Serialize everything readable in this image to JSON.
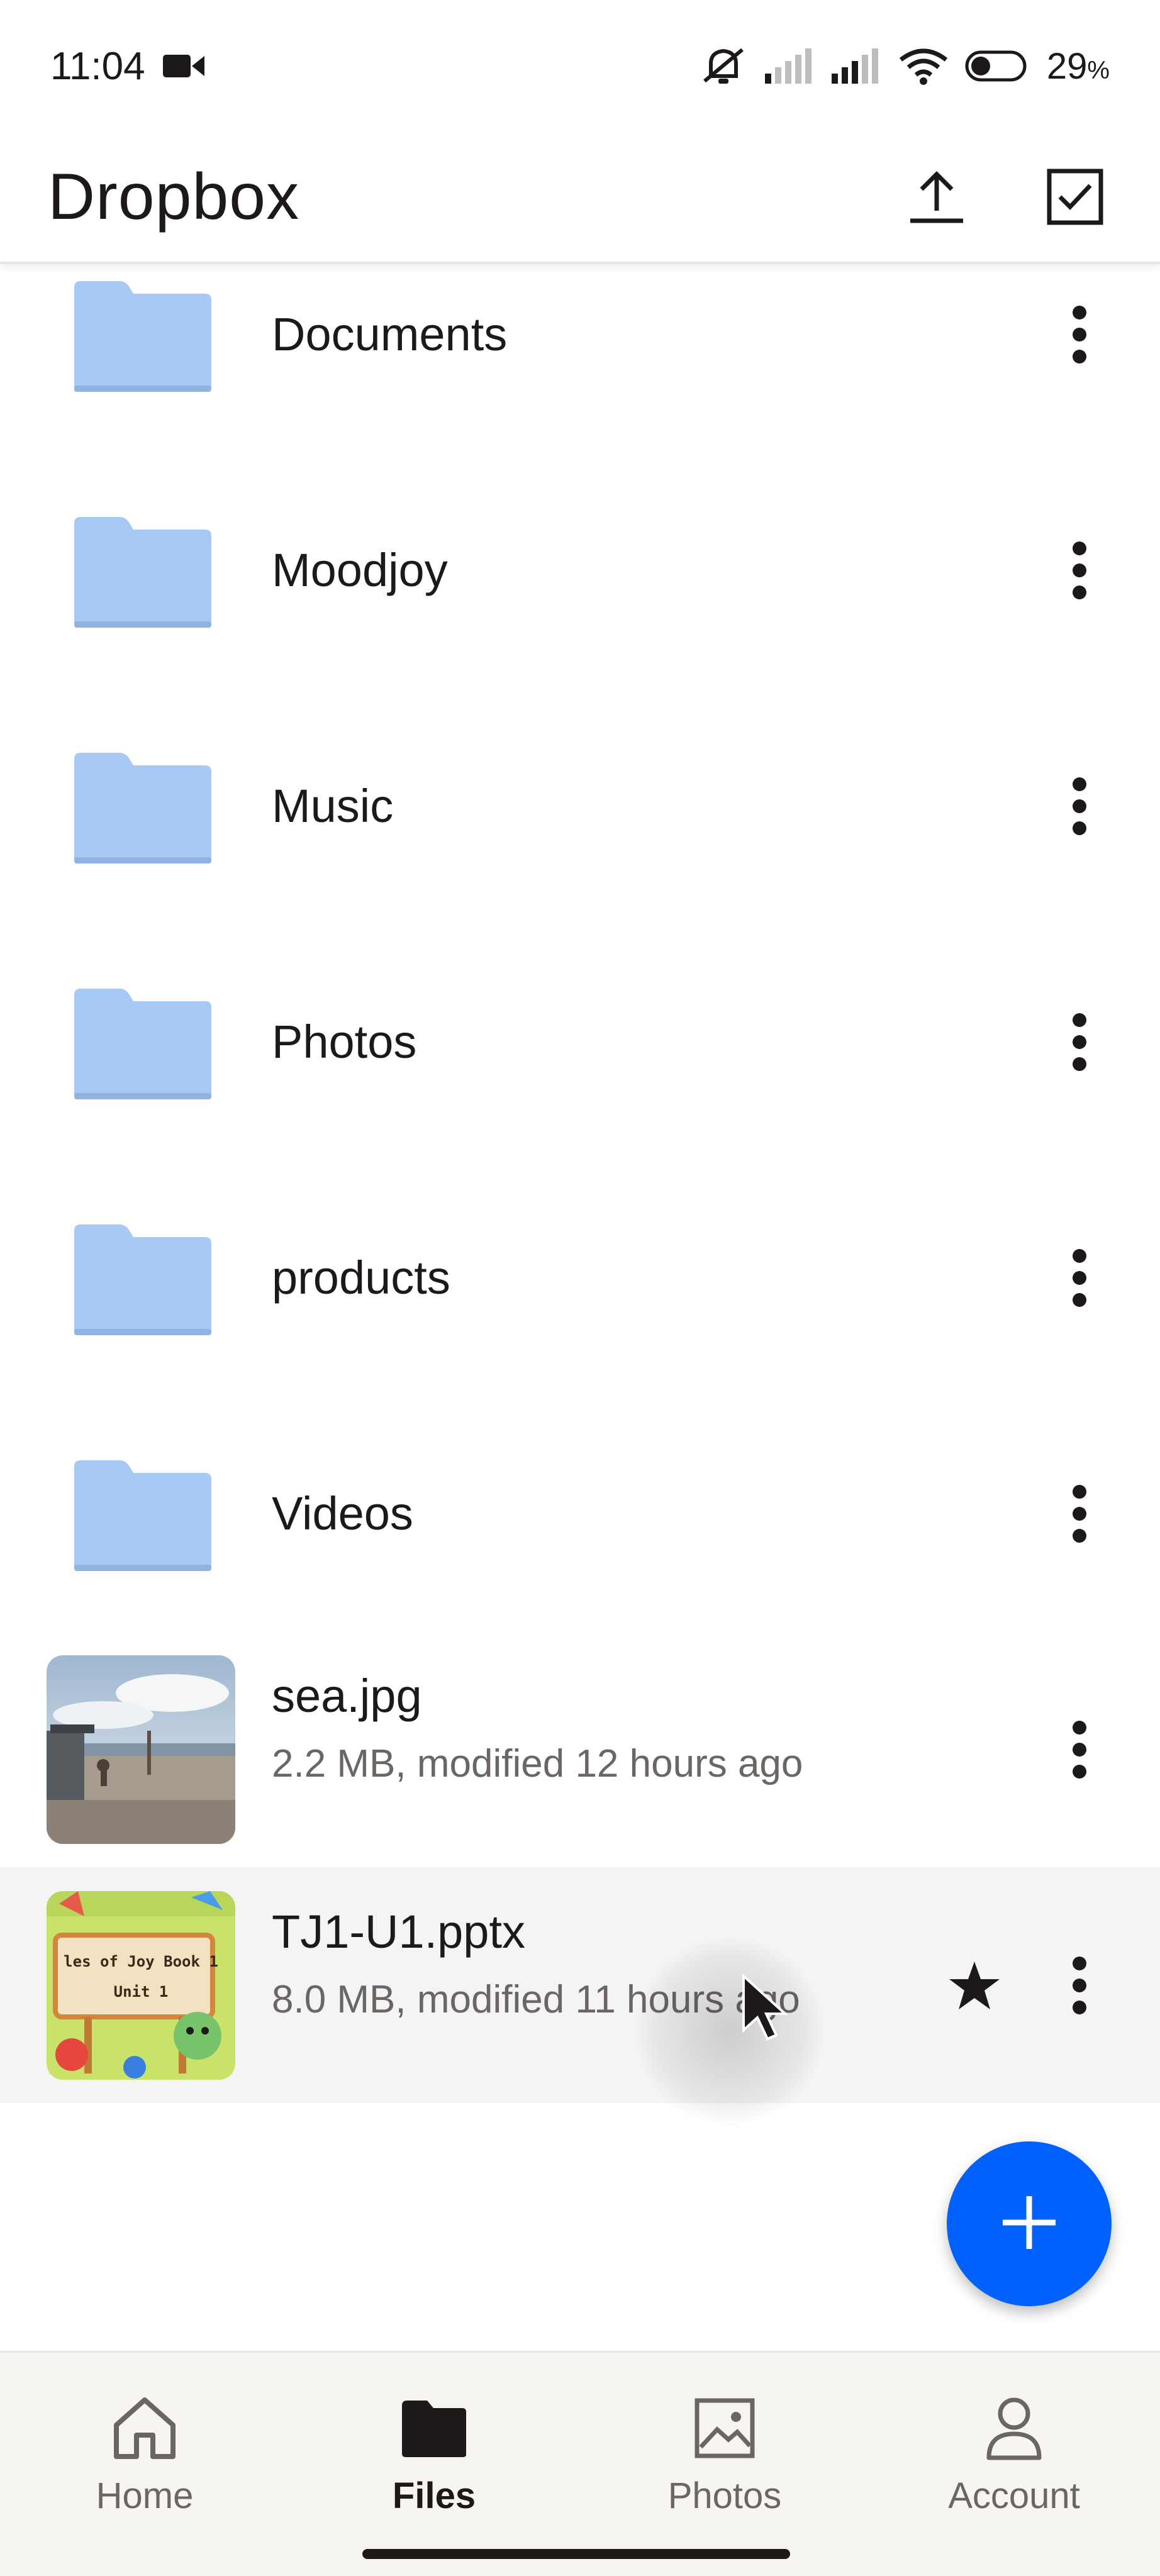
{
  "status_bar": {
    "time": "11:04",
    "battery_percent": "29",
    "battery_unit": "%",
    "icons": [
      "video-camera-icon",
      "mute-icon",
      "signal-icon",
      "signal-icon",
      "wifi-icon",
      "battery-icon"
    ]
  },
  "app_bar": {
    "title": "Dropbox",
    "actions": [
      "upload-icon",
      "select-checkbox-icon"
    ]
  },
  "list": {
    "folders": [
      {
        "name": "Documents"
      },
      {
        "name": "Moodjoy"
      },
      {
        "name": "Music"
      },
      {
        "name": "Photos"
      },
      {
        "name": "products"
      },
      {
        "name": "Videos"
      }
    ],
    "files": [
      {
        "name": "sea.jpg",
        "meta": "2.2 MB, modified 12 hours ago",
        "starred": false
      },
      {
        "name": "TJ1-U1.pptx",
        "meta": "8.0 MB, modified 11 hours ago",
        "starred": true,
        "selected": true,
        "thumb_text_line1": "les of Joy Book 1",
        "thumb_text_line2": "Unit 1"
      }
    ]
  },
  "fab": {
    "icon": "plus-icon"
  },
  "bottom_nav": {
    "items": [
      {
        "label": "Home",
        "icon": "home-icon",
        "active": false
      },
      {
        "label": "Files",
        "icon": "folder-icon",
        "active": true
      },
      {
        "label": "Photos",
        "icon": "image-icon",
        "active": false
      },
      {
        "label": "Account",
        "icon": "person-icon",
        "active": false
      }
    ]
  },
  "colors": {
    "accent": "#0061fe",
    "folder": "#a8c9f3",
    "folder_dark": "#8fb4e2",
    "text_primary": "#1e1919",
    "text_secondary": "#6b6663"
  }
}
